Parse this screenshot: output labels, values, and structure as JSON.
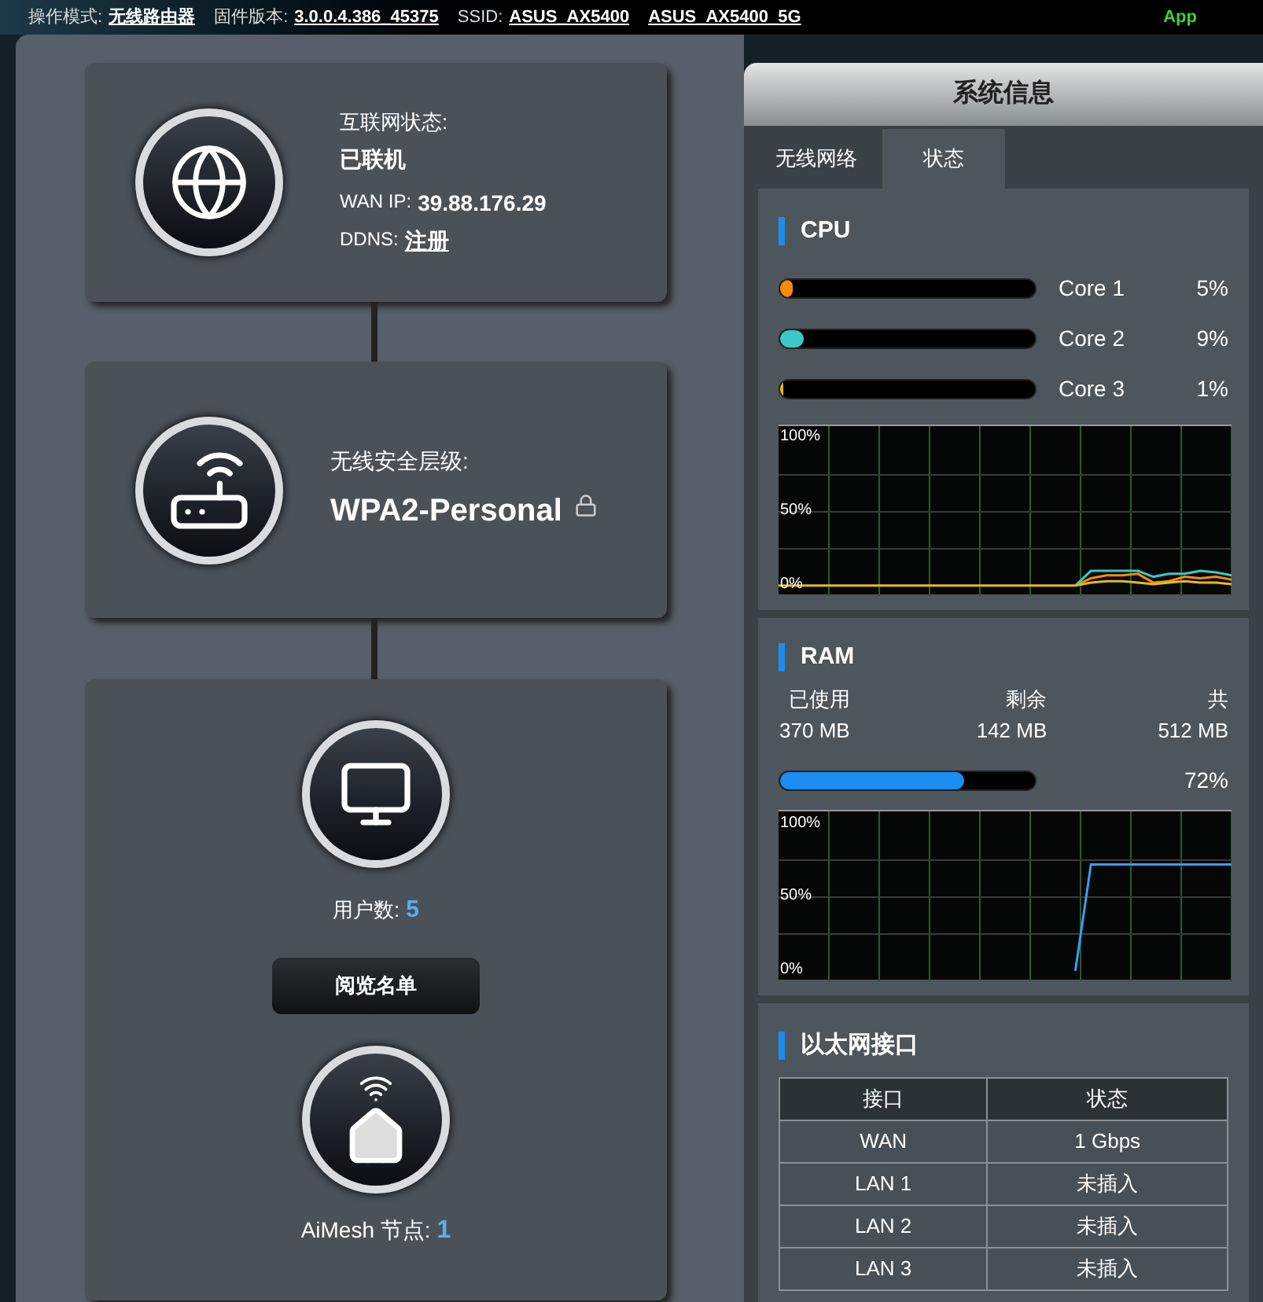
{
  "top_bar": {
    "items": [
      {
        "label": "操作模式:",
        "value": "无线路由器"
      },
      {
        "label": "固件版本:",
        "value": "3.0.0.4.386_45375"
      },
      {
        "label": "SSID:",
        "value": "ASUS_AX5400"
      },
      {
        "value": "ASUS_AX5400_5G"
      }
    ],
    "app": "App"
  },
  "internet": {
    "status_label": "互联网状态:",
    "status": "已联机",
    "wan_ip_label": "WAN IP:",
    "wan_ip": "39.88.176.29",
    "ddns_label": "DDNS:",
    "ddns_link": "注册"
  },
  "wireless": {
    "label": "无线安全层级:",
    "value": "WPA2-Personal"
  },
  "clients": {
    "label": "用户数:",
    "count": "5",
    "button": "阅览名单"
  },
  "aimesh": {
    "label": "AiMesh 节点:",
    "count": "1"
  },
  "panel": {
    "title": "系统信息",
    "tabs": [
      {
        "label": "无线网络",
        "selected": false
      },
      {
        "label": "状态",
        "selected": true
      }
    ]
  },
  "cpu": {
    "title": "CPU",
    "cores": [
      {
        "name": "Core 1",
        "reading": "5%",
        "level": 0.05,
        "color": "#ff8c00"
      },
      {
        "name": "Core 2",
        "reading": "9%",
        "level": 0.09,
        "color": "#3cc8c8"
      },
      {
        "name": "Core 3",
        "reading": "1%",
        "level": 0.01,
        "color": "#e8b820"
      }
    ],
    "chart_data": {
      "type": "line",
      "ylim": [
        -7,
        108
      ],
      "yticks": [
        {
          "value": 0,
          "label": "0%"
        },
        {
          "value": 50,
          "label": "50%"
        },
        {
          "value": 100,
          "label": "100%"
        }
      ],
      "series": [
        {
          "color": "#ff8c00",
          "values": [
            null,
            null,
            null,
            null,
            null,
            null,
            null,
            null,
            null,
            null,
            null,
            null,
            null,
            null,
            null,
            null,
            null,
            null,
            null,
            0,
            5,
            7,
            7,
            8,
            2,
            3,
            6,
            5,
            6,
            4
          ]
        },
        {
          "color": "#3cc8c8",
          "values": [
            null,
            null,
            null,
            null,
            null,
            null,
            null,
            null,
            null,
            null,
            null,
            null,
            null,
            null,
            null,
            null,
            null,
            null,
            null,
            0,
            10,
            10,
            10,
            10,
            6,
            8,
            8,
            10,
            9,
            7
          ]
        },
        {
          "color": "#e8b820",
          "values": [
            0,
            0,
            0,
            0,
            0,
            0,
            0,
            0,
            0,
            0,
            0,
            0,
            0,
            0,
            0,
            0,
            0,
            0,
            0,
            0,
            2,
            3,
            3,
            2,
            1,
            2,
            3,
            2,
            2,
            1
          ]
        }
      ]
    }
  },
  "ram": {
    "title": "RAM",
    "columns": [
      {
        "label": "已使用",
        "value": "370 MB"
      },
      {
        "label": "剩余",
        "value": "142 MB"
      },
      {
        "label": "共",
        "value": "512 MB"
      }
    ],
    "level": 0.72,
    "reading": "72%",
    "chart_data": {
      "type": "line",
      "ylim": [
        -7,
        108
      ],
      "yticks": [
        {
          "value": 0,
          "label": "0%"
        },
        {
          "value": 50,
          "label": "50%"
        },
        {
          "value": 100,
          "label": "100%"
        }
      ],
      "series": [
        {
          "color": "#3c9cf0",
          "values": [
            null,
            null,
            null,
            null,
            null,
            null,
            null,
            null,
            null,
            null,
            null,
            null,
            null,
            null,
            null,
            null,
            null,
            null,
            null,
            0,
            72,
            72,
            72,
            72,
            72,
            72,
            72,
            72,
            72,
            72
          ]
        }
      ]
    }
  },
  "ethernet": {
    "title": "以太网接口",
    "columns": [
      "接口",
      "状态"
    ],
    "rows": [
      [
        "WAN",
        "1 Gbps"
      ],
      [
        "LAN 1",
        "未插入"
      ],
      [
        "LAN 2",
        "未插入"
      ],
      [
        "LAN 3",
        "未插入"
      ]
    ]
  }
}
